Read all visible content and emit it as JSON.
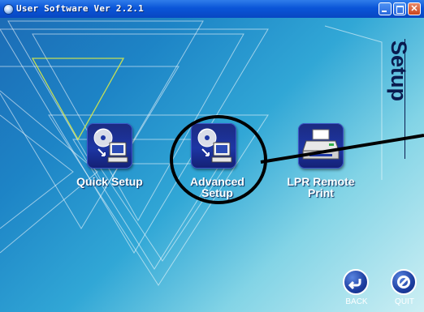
{
  "window": {
    "title": "User Software Ver 2.2.1"
  },
  "page": {
    "heading": "Setup"
  },
  "buttons": [
    {
      "id": "quick-setup",
      "label_lines": [
        "Quick Setup"
      ],
      "icon": "cd-to-computer-icon"
    },
    {
      "id": "advanced-setup",
      "label_lines": [
        "Advanced",
        "Setup"
      ],
      "icon": "cd-to-computer-icon"
    },
    {
      "id": "lpr-remote-print",
      "label_lines": [
        "LPR Remote",
        "Print"
      ],
      "icon": "printer-icon"
    }
  ],
  "nav": {
    "back_label": "BACK",
    "quit_label": "QUIT"
  },
  "colors": {
    "titlebar": "#0a55d8",
    "icon_tile": "#1d36a4",
    "heading_text": "#0a1b4e",
    "annotation_stroke": "#000000"
  },
  "annotation": {
    "type": "circle-with-pointer-line",
    "highlights": "advanced-setup"
  }
}
